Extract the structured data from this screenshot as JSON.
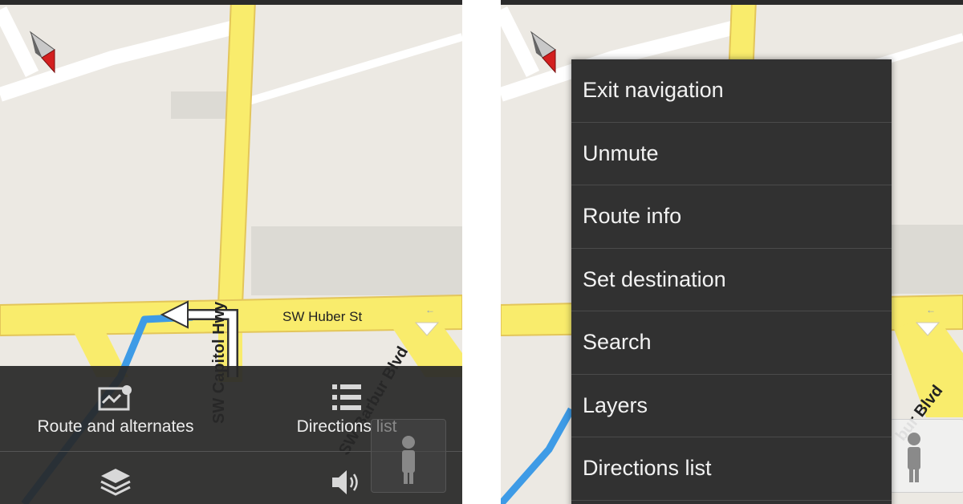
{
  "left_screen": {
    "street_labels": {
      "huber": "SW Huber St",
      "capitol": "SW Capitol Hwy",
      "barbur": "SW Barbur Blvd"
    },
    "bottom_sheet": {
      "route_and_alternates": {
        "label": "Route and alternates",
        "icon": "route-map-icon"
      },
      "directions_list": {
        "label": "Directions list",
        "icon": "list-icon"
      },
      "layers": {
        "icon": "layers-icon"
      },
      "sound": {
        "icon": "speaker-icon"
      }
    }
  },
  "right_screen": {
    "street_labels": {
      "barbur_partial": "bur Blvd"
    },
    "menu": {
      "items": [
        "Exit navigation",
        "Unmute",
        "Route info",
        "Set destination",
        "Search",
        "Layers",
        "Directions list"
      ]
    }
  },
  "colors": {
    "map_background": "#ece9e3",
    "major_road": "#f9ec6c",
    "road_outline": "#e3c65a",
    "minor_road": "#ffffff",
    "route": "#3e9be6",
    "menu_background": "#313131",
    "sheet_background": "#282828"
  }
}
